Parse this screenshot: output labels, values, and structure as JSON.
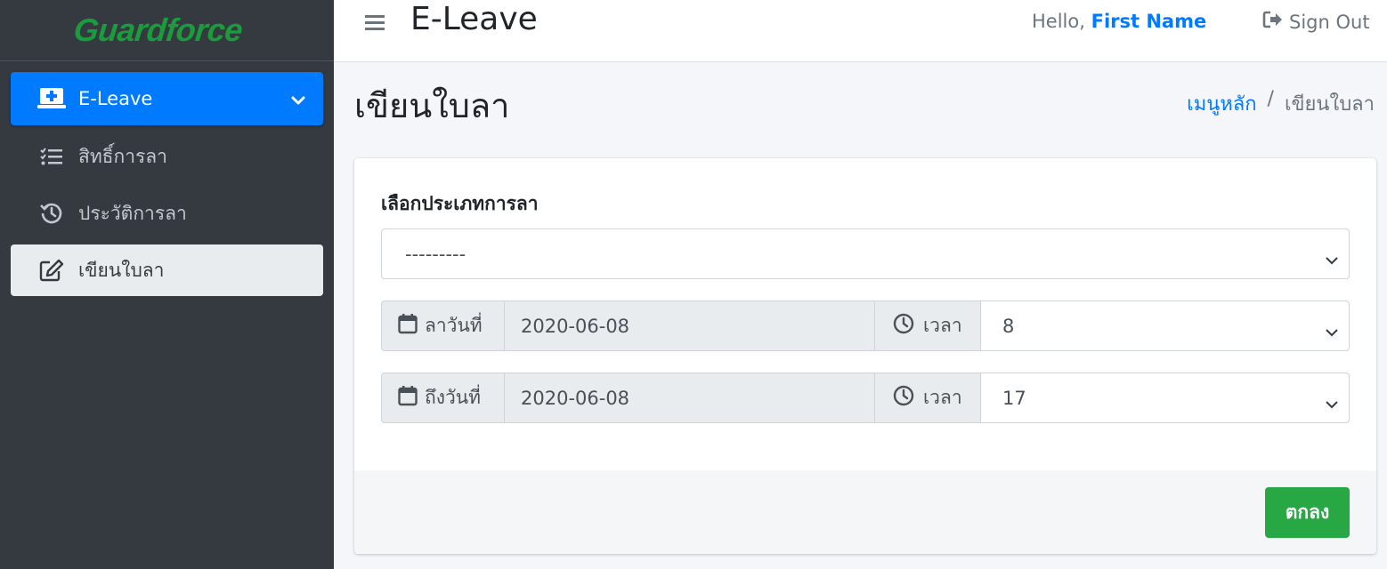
{
  "brand": {
    "logo_text": "Guardforce",
    "logo_color": "#1b9c3c"
  },
  "sidebar": {
    "main_item": {
      "label": "E-Leave",
      "icon": "laptop-medical-icon"
    },
    "items": [
      {
        "label": "สิทธิ์การลา",
        "icon": "tasks-list-icon"
      },
      {
        "label": "ประวัติการลา",
        "icon": "history-icon"
      },
      {
        "label": "เขียนใบลา",
        "icon": "edit-icon"
      }
    ]
  },
  "header": {
    "title": "E-Leave",
    "greeting": "Hello,",
    "user_name": "First Name",
    "sign_out": "Sign Out"
  },
  "page": {
    "title": "เขียนใบลา",
    "breadcrumb": {
      "home": "เมนูหลัก",
      "separator": "/",
      "current": "เขียนใบลา"
    }
  },
  "form": {
    "leave_type_label": "เลือกประเภทการลา",
    "leave_type_value": "---------",
    "from": {
      "label": "ลาวันที่",
      "date": "2020-06-08",
      "time_label": "เวลา",
      "time_value": "8"
    },
    "to": {
      "label": "ถึงวันที่",
      "date": "2020-06-08",
      "time_label": "เวลา",
      "time_value": "17"
    },
    "submit_label": "ตกลง"
  },
  "colors": {
    "primary": "#007bff",
    "success": "#28a745",
    "sidebar_bg": "#343a40"
  }
}
